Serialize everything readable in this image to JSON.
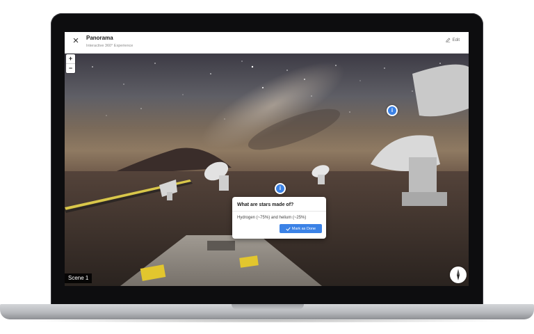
{
  "header": {
    "title": "Panorama",
    "subtitle": "Interactive 360° Experience",
    "edit_label": "Edit"
  },
  "zoom": {
    "in_label": "+",
    "out_label": "−"
  },
  "hotspots": [
    {
      "icon": "info-icon",
      "glyph": "i"
    },
    {
      "icon": "info-icon",
      "glyph": "i"
    }
  ],
  "popup": {
    "question": "What are stars made of?",
    "answer": "Hydrogen (~75%) and helium (~25%)",
    "button_label": "Mark as Done"
  },
  "scene": {
    "label": "Scene 1"
  },
  "colors": {
    "accent": "#3b82e6",
    "header_bg": "#ffffff"
  }
}
